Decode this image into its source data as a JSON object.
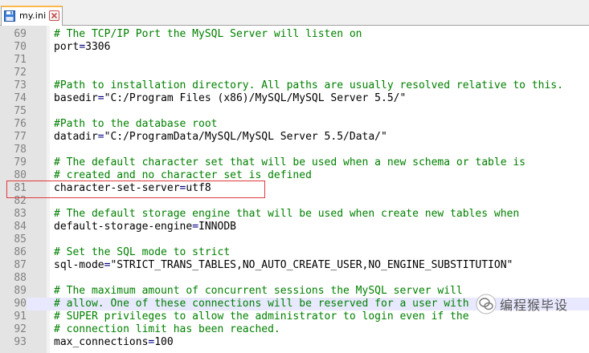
{
  "tab": {
    "label": "my.ini"
  },
  "editor": {
    "lines": [
      {
        "num": "69",
        "parts": [
          {
            "t": "# The TCP/IP Port the MySQL Server will listen on",
            "c": "comment"
          }
        ]
      },
      {
        "num": "70",
        "parts": [
          {
            "t": "port",
            "c": ""
          },
          {
            "t": "=",
            "c": "op"
          },
          {
            "t": "3306",
            "c": ""
          }
        ]
      },
      {
        "num": "71",
        "parts": []
      },
      {
        "num": "72",
        "parts": []
      },
      {
        "num": "73",
        "parts": [
          {
            "t": "#Path to installation directory. All paths are usually resolved relative to this.",
            "c": "comment"
          }
        ]
      },
      {
        "num": "74",
        "parts": [
          {
            "t": "basedir",
            "c": ""
          },
          {
            "t": "=",
            "c": "op"
          },
          {
            "t": "\"C:/Program Files (x86)/MySQL/MySQL Server 5.5/\"",
            "c": ""
          }
        ]
      },
      {
        "num": "75",
        "parts": []
      },
      {
        "num": "76",
        "parts": [
          {
            "t": "#Path to the database root",
            "c": "comment"
          }
        ]
      },
      {
        "num": "77",
        "parts": [
          {
            "t": "datadir",
            "c": ""
          },
          {
            "t": "=",
            "c": "op"
          },
          {
            "t": "\"C:/ProgramData/MySQL/MySQL Server 5.5/Data/\"",
            "c": ""
          }
        ]
      },
      {
        "num": "78",
        "parts": []
      },
      {
        "num": "79",
        "parts": [
          {
            "t": "# The default character set that will be used when a new schema or table is",
            "c": "comment"
          }
        ]
      },
      {
        "num": "80",
        "parts": [
          {
            "t": "# created and no character set is defined",
            "c": "comment"
          }
        ]
      },
      {
        "num": "81",
        "parts": [
          {
            "t": "character-set-server",
            "c": ""
          },
          {
            "t": "=",
            "c": "op"
          },
          {
            "t": "utf8",
            "c": ""
          }
        ]
      },
      {
        "num": "82",
        "parts": []
      },
      {
        "num": "83",
        "parts": [
          {
            "t": "# The default storage engine that will be used when create new tables when",
            "c": "comment"
          }
        ]
      },
      {
        "num": "84",
        "parts": [
          {
            "t": "default-storage-engine",
            "c": ""
          },
          {
            "t": "=",
            "c": "op"
          },
          {
            "t": "INNODB",
            "c": ""
          }
        ]
      },
      {
        "num": "85",
        "parts": []
      },
      {
        "num": "86",
        "parts": [
          {
            "t": "# Set the SQL mode to strict",
            "c": "comment"
          }
        ]
      },
      {
        "num": "87",
        "parts": [
          {
            "t": "sql-mode",
            "c": ""
          },
          {
            "t": "=",
            "c": "op"
          },
          {
            "t": "\"STRICT_TRANS_TABLES,NO_AUTO_CREATE_USER,NO_ENGINE_SUBSTITUTION\"",
            "c": ""
          }
        ]
      },
      {
        "num": "88",
        "parts": []
      },
      {
        "num": "89",
        "parts": [
          {
            "t": "# The maximum amount of concurrent sessions the MySQL server will",
            "c": "comment"
          }
        ]
      },
      {
        "num": "90",
        "parts": [
          {
            "t": "# allow. One of these connections will be reserved for a user with",
            "c": "comment"
          }
        ],
        "current": true
      },
      {
        "num": "91",
        "parts": [
          {
            "t": "# SUPER privileges to allow the administrator to login even if the",
            "c": "comment"
          }
        ]
      },
      {
        "num": "92",
        "parts": [
          {
            "t": "# connection limit has been reached.",
            "c": "comment"
          }
        ]
      },
      {
        "num": "93",
        "parts": [
          {
            "t": "max_connections",
            "c": ""
          },
          {
            "t": "=",
            "c": "op"
          },
          {
            "t": "100",
            "c": ""
          }
        ]
      }
    ]
  },
  "watermark": {
    "text": "编程猴毕设"
  },
  "colors": {
    "comment": "#008000",
    "operator": "#000080",
    "highlight_box": "#e03a3a",
    "current_line": "#e8e8ff",
    "gutter": "#e4e4e4"
  }
}
